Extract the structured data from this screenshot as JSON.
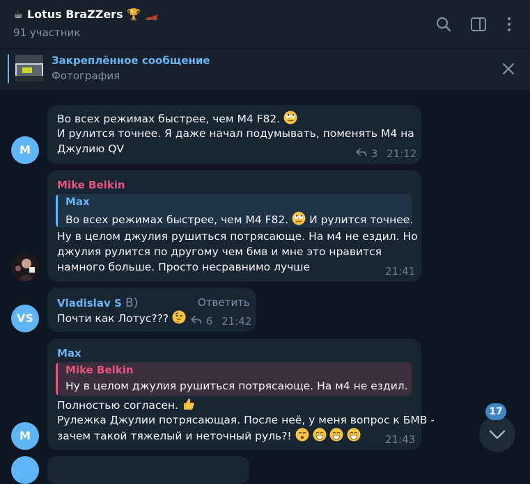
{
  "header": {
    "title": "☕ Lotus BraZZers 🏆 🏎️",
    "subtitle": "91 участник"
  },
  "pinned": {
    "title": "Закреплённое сообщение",
    "subtitle": "Фотография"
  },
  "messages": [
    {
      "lines": [
        "Во всех режимах быстрее, чем M4 F82.",
        "И рулится точнее. Я даже начал подумывать, поменять М4 на",
        "Джулию QV"
      ],
      "replies": "3",
      "time": "21:12",
      "avatar_letter": "M"
    },
    {
      "sender": "Mike Belkin",
      "quote_name": "Max",
      "quote_text": "Во всех режимах быстрее, чем M4 F82.",
      "quote_text_tail": "И рулится точнее....",
      "lines": [
        "Ну в целом джулия рушиться потрясающе. На м4 не ездил. Но",
        "джулия рулится по другому чем бмв и мне это нравится",
        "намного больше. Просто несравнимо лучше"
      ],
      "time": "21:41"
    },
    {
      "sender": "Vladislav S",
      "sender_suffix": "B)",
      "reply_label": "Ответить",
      "lines": [
        "Почти как Лотус???"
      ],
      "replies": "6",
      "time": "21:42",
      "avatar_letter": "VS"
    },
    {
      "sender": "Max",
      "quote_name": "Mike Belkin",
      "quote_text": "Ну в целом джулия рушиться потрясающе. На м4 не ездил. Н...",
      "lines": [
        "Полностью согласен.",
        "Рулежка Джулии потрясающая. После неё, у меня вопрос к БМВ -",
        "зачем такой тяжелый и неточный руль?!"
      ],
      "time": "21:43",
      "avatar_letter": "M"
    }
  ],
  "scroll_badge": "17",
  "colors": {
    "background": "#0e1621",
    "header": "#17212b",
    "bubble": "#182533",
    "accent": "#6ab3f3",
    "pink_name": "#e9537f",
    "avatar_blue": "#5eb5f7"
  }
}
